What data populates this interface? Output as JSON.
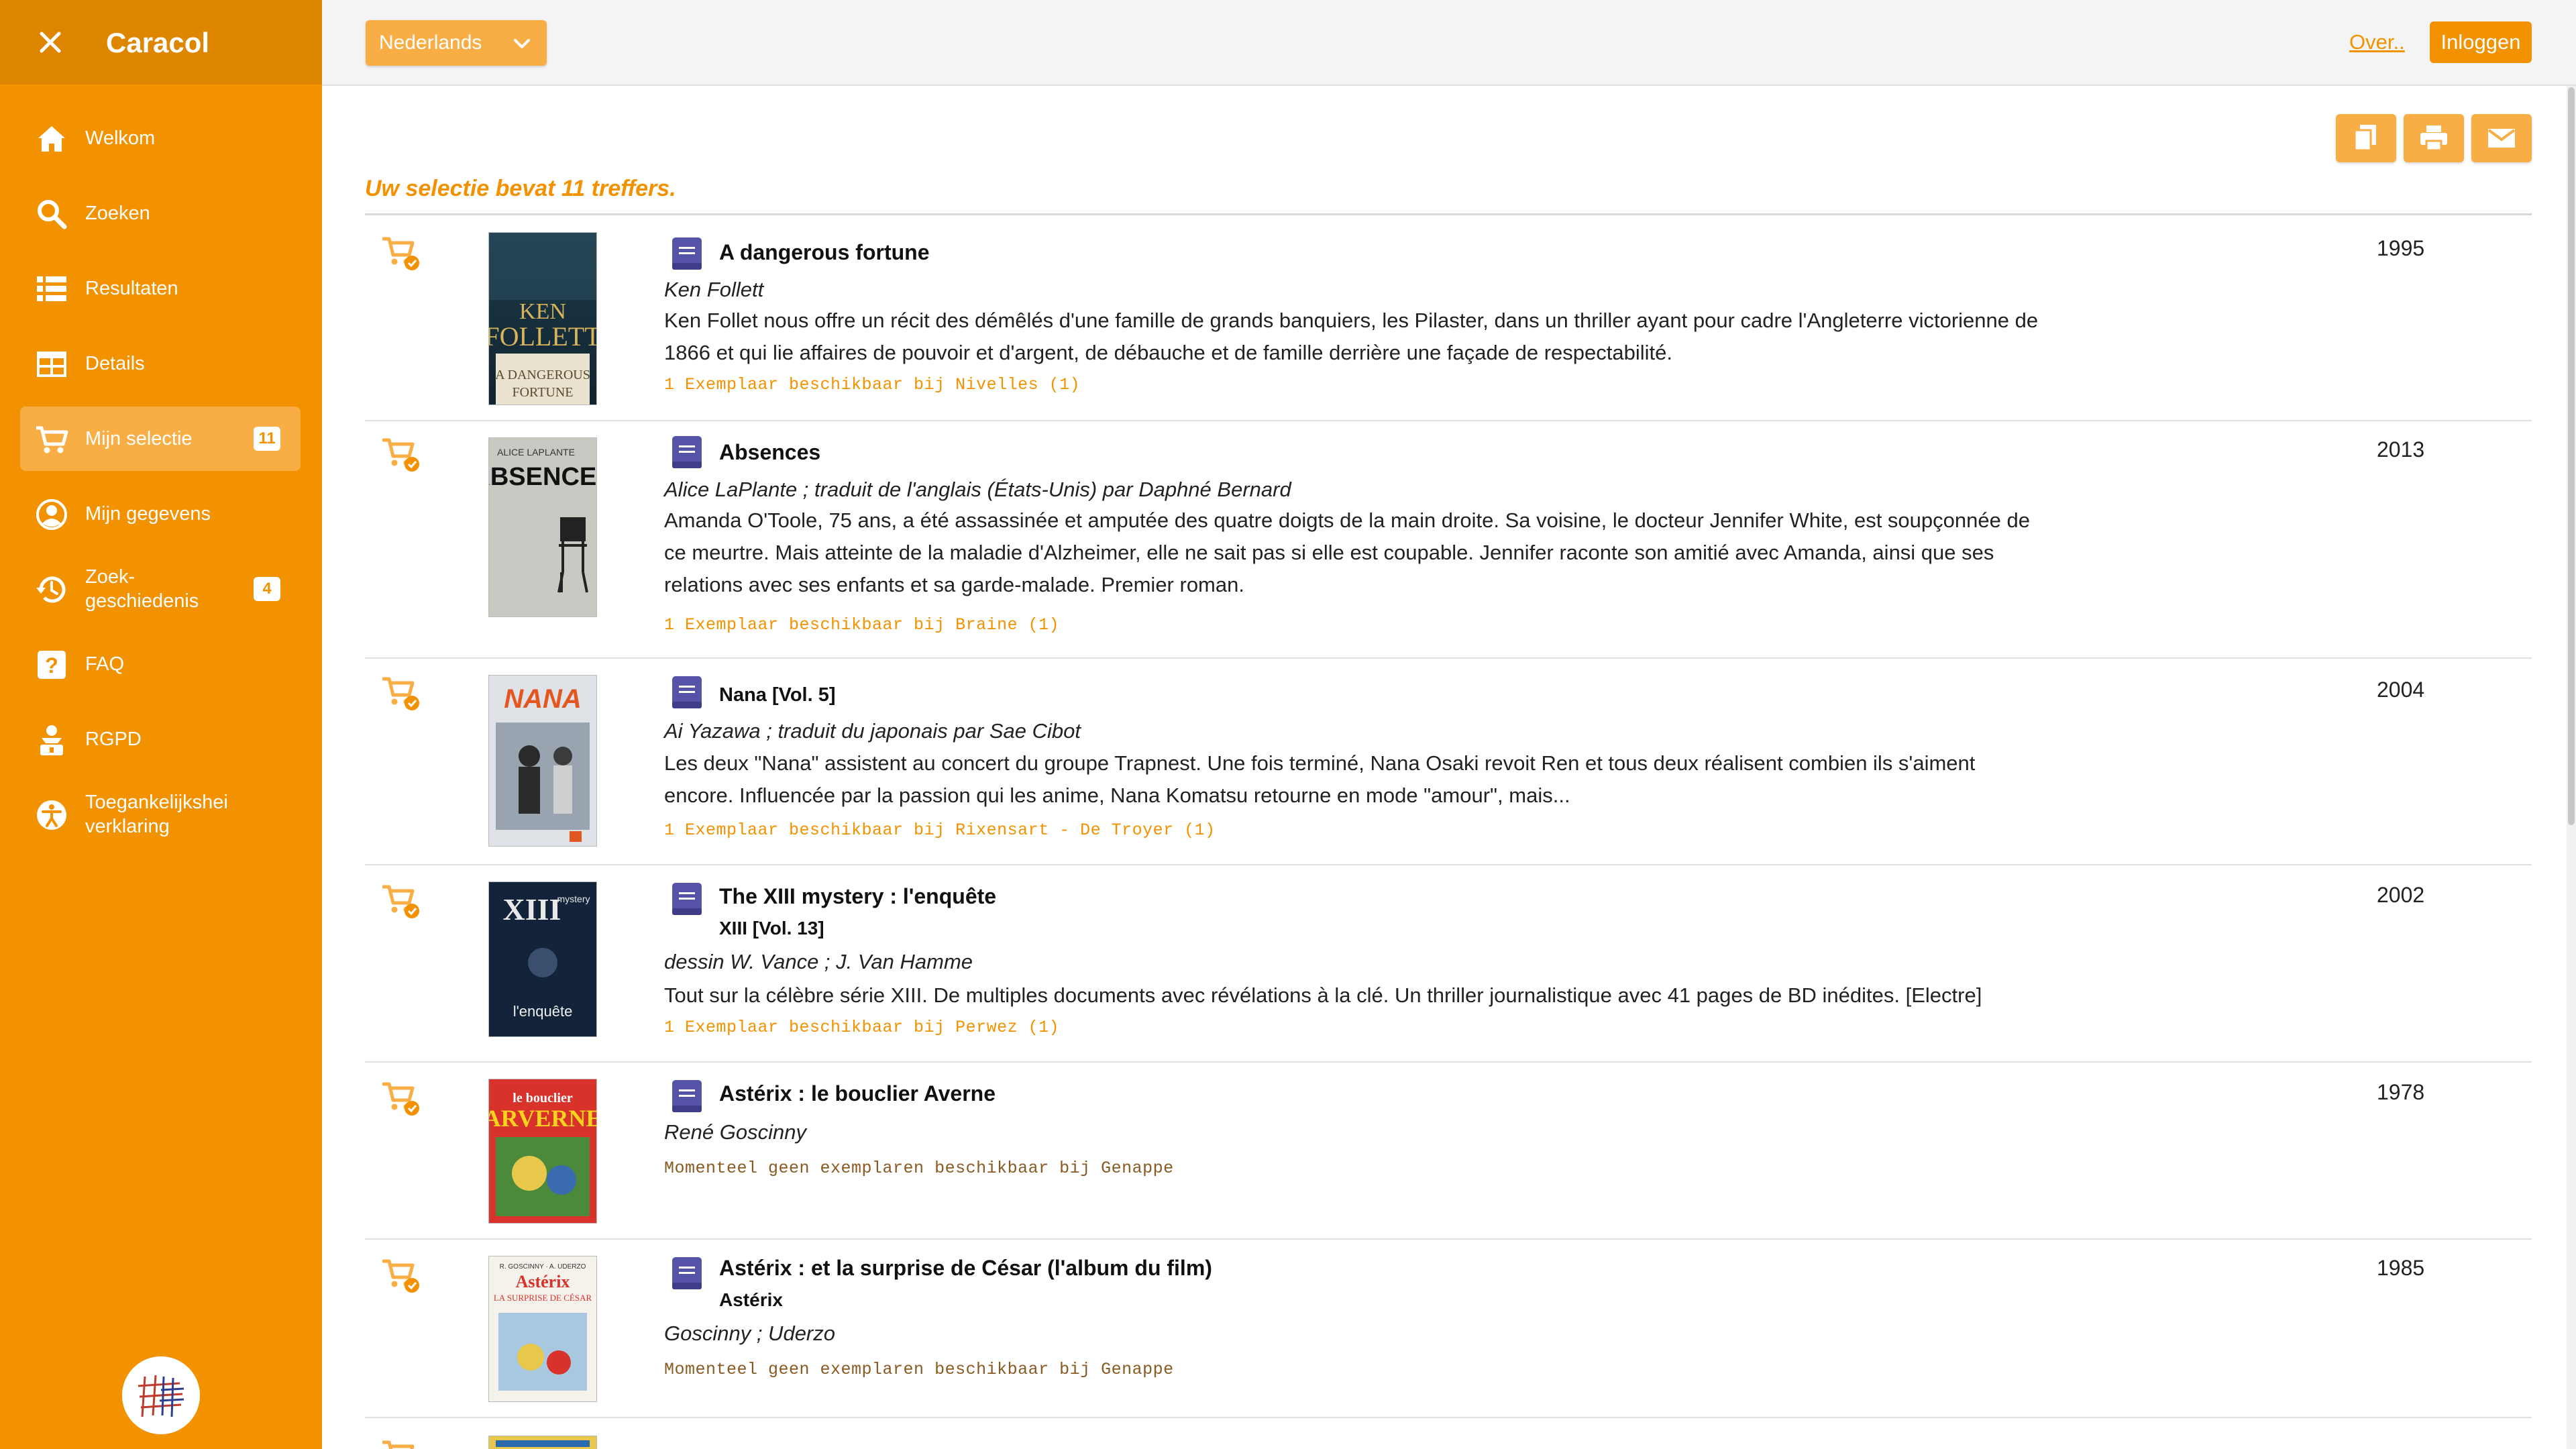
{
  "sidebar": {
    "app_title": "Caracol",
    "items": [
      {
        "label": "Welkom",
        "icon": "home-icon"
      },
      {
        "label": "Zoeken",
        "icon": "search-icon"
      },
      {
        "label": "Resultaten",
        "icon": "list-icon"
      },
      {
        "label": "Details",
        "icon": "details-icon"
      },
      {
        "label": "Mijn selectie",
        "icon": "cart-icon",
        "badge": "11",
        "active": true
      },
      {
        "label": "Mijn gegevens",
        "icon": "user-icon"
      },
      {
        "label": "Zoek-\ngeschiedenis",
        "icon": "history-icon",
        "badge": "4"
      },
      {
        "label": "FAQ",
        "icon": "faq-icon"
      },
      {
        "label": "RGPD",
        "icon": "privacy-icon"
      },
      {
        "label": "Toegankelijkshei\nverklaring",
        "icon": "accessibility-icon"
      }
    ]
  },
  "topbar": {
    "language": "Nederlands",
    "about": "Over..",
    "login": "Inloggen"
  },
  "results": {
    "heading": "Uw selectie bevat 11 treffers.",
    "items": [
      {
        "title": "A dangerous fortune",
        "author": "Ken Follett",
        "summary": "Ken Follet nous offre un récit des démêlés d'une famille de grands banquiers, les Pilaster, dans un thriller ayant pour cadre l'Angleterre victorienne de 1866 et qui lie affaires de pouvoir et d'argent, de débauche et de famille derrière une façade de respectabilité.",
        "availability": "1 Exemplaar beschikbaar bij Nivelles (1)",
        "year": "1995",
        "cover_text": "KEN FOLLETT A DANGEROUS FORTUNE"
      },
      {
        "title": "Absences",
        "author": "Alice LaPlante ; traduit de l'anglais (États-Unis) par Daphné Bernard",
        "summary": "Amanda O'Toole, 75 ans, a été assassinée et amputée des quatre doigts de la main droite. Sa voisine, le docteur Jennifer White, est soupçonnée de ce meurtre. Mais atteinte de la maladie d'Alzheimer, elle ne sait pas si elle est coupable. Jennifer raconte son amitié avec Amanda, ainsi que ses relations avec ses enfants et sa garde-malade. Premier roman.",
        "availability": "1 Exemplaar beschikbaar bij Braine (1)",
        "year": "2013",
        "cover_text": "ABSENCES"
      },
      {
        "title": "Nana [Vol. 5]",
        "author": "Ai Yazawa ; traduit du japonais par Sae Cibot",
        "summary": "Les deux \"Nana\" assistent au concert du groupe Trapnest. Une fois terminé, Nana Osaki revoit Ren et tous deux réalisent combien ils s'aiment encore. Influencée par la passion qui les anime, Nana Komatsu retourne en mode \"amour\", mais...",
        "availability": "1 Exemplaar beschikbaar bij Rixensart - De Troyer (1)",
        "year": "2004",
        "cover_text": "NANA"
      },
      {
        "title": "The XIII mystery : l'enquête",
        "series": "XIII [Vol. 13]",
        "author": "dessin W. Vance ; J. Van Hamme",
        "summary": "Tout sur la célèbre série XIII. De multiples documents avec révélations à la clé. Un thriller journalistique avec 41 pages de BD inédites. [Electre]",
        "availability": "1 Exemplaar beschikbaar bij Perwez (1)",
        "year": "2002",
        "cover_text": "XIII l'enquête"
      },
      {
        "title": "Astérix : le bouclier Averne",
        "author": "René Goscinny",
        "availability": "Momenteel geen exemplaren beschikbaar bij Genappe",
        "year": "1978",
        "cover_text": "le bouclier ARVERNE"
      },
      {
        "title": "Astérix : et la surprise de César (l'album du film)",
        "series": "Astérix",
        "author": "Goscinny ; Uderzo",
        "availability": "Momenteel geen exemplaren beschikbaar bij Genappe",
        "year": "1985",
        "cover_text": "Astérix LA SURPRISE DE CÉSAR"
      }
    ]
  },
  "colors": {
    "brand": "#f39200",
    "brand_dark": "#de8600",
    "brand_light": "#f8ae44",
    "book_icon": "#5552a8"
  }
}
